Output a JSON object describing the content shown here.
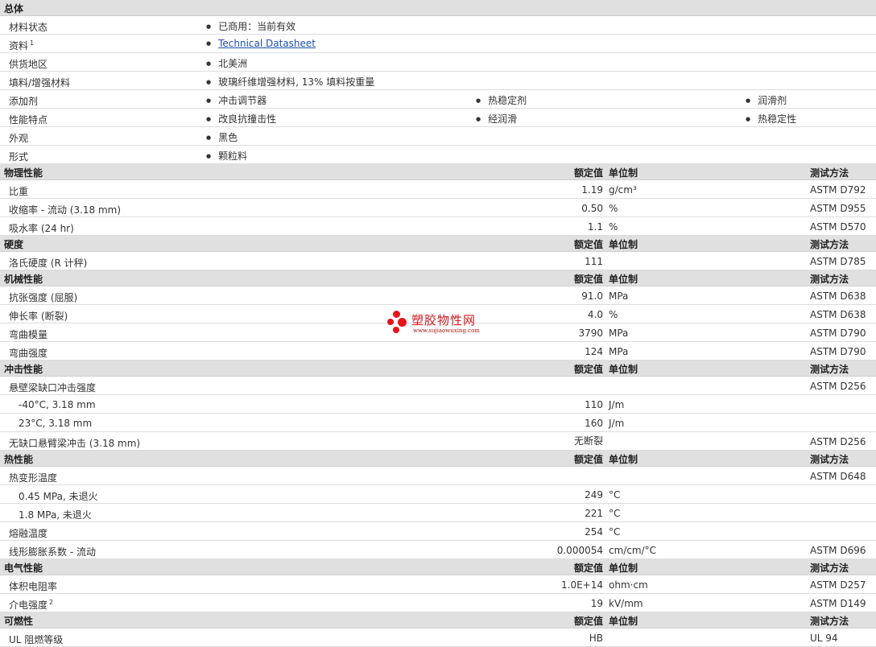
{
  "headers": {
    "value": "额定值",
    "unit": "单位制",
    "method": "测试方法"
  },
  "general": {
    "title": "总体",
    "rows": [
      {
        "label": "材料状态",
        "items": [
          "已商用：当前有效"
        ]
      },
      {
        "label": "资料",
        "sup": "1",
        "link": "Technical Datasheet"
      },
      {
        "label": "供货地区",
        "items": [
          "北美洲"
        ]
      },
      {
        "label": "填料/增强材料",
        "items": [
          "玻璃纤维增强材料, 13% 填料按重量"
        ]
      },
      {
        "label": "添加剂",
        "items": [
          "冲击调节器",
          "热稳定剂",
          "润滑剂"
        ]
      },
      {
        "label": "性能特点",
        "items": [
          "改良抗撞击性",
          "经润滑",
          "热稳定性"
        ]
      },
      {
        "label": "外观",
        "items": [
          "黑色"
        ]
      },
      {
        "label": "形式",
        "items": [
          "颗粒料"
        ]
      }
    ]
  },
  "sections": [
    {
      "title": "物理性能",
      "rows": [
        {
          "label": "比重",
          "value": "1.19",
          "unit": "g/cm³",
          "method": "ASTM D792"
        },
        {
          "label": "收缩率  - 流动  (3.18 mm)",
          "value": "0.50",
          "unit": "%",
          "method": "ASTM D955"
        },
        {
          "label": "吸水率  (24 hr)",
          "value": "1.1",
          "unit": "%",
          "method": "ASTM D570"
        }
      ]
    },
    {
      "title": "硬度",
      "rows": [
        {
          "label": "洛氏硬度  (R 计秤)",
          "value": "111",
          "unit": "",
          "method": "ASTM D785"
        }
      ]
    },
    {
      "title": "机械性能",
      "rows": [
        {
          "label": "抗张强度  (屈服)",
          "value": "91.0",
          "unit": "MPa",
          "method": "ASTM D638"
        },
        {
          "label": "伸长率  (断裂)",
          "value": "4.0",
          "unit": "%",
          "method": "ASTM D638"
        },
        {
          "label": "弯曲模量",
          "value": "3790",
          "unit": "MPa",
          "method": "ASTM D790"
        },
        {
          "label": "弯曲强度",
          "value": "124",
          "unit": "MPa",
          "method": "ASTM D790"
        }
      ]
    },
    {
      "title": "冲击性能",
      "rows": [
        {
          "label": "悬壁梁缺口冲击强度",
          "value": "",
          "unit": "",
          "method": "ASTM D256"
        },
        {
          "label": "-40°C, 3.18 mm",
          "value": "110",
          "unit": "J/m",
          "method": "",
          "sub": true
        },
        {
          "label": "23°C, 3.18 mm",
          "value": "160",
          "unit": "J/m",
          "method": "",
          "sub": true
        },
        {
          "label": "无缺口悬臂梁冲击  (3.18 mm)",
          "value": "无断裂",
          "unit": "",
          "method": "ASTM D256"
        }
      ]
    },
    {
      "title": "热性能",
      "rows": [
        {
          "label": "热变形温度",
          "value": "",
          "unit": "",
          "method": "ASTM D648"
        },
        {
          "label": "0.45 MPa, 未退火",
          "value": "249",
          "unit": "°C",
          "method": "",
          "sub": true
        },
        {
          "label": "1.8 MPa, 未退火",
          "value": "221",
          "unit": "°C",
          "method": "",
          "sub": true
        },
        {
          "label": "熔融温度",
          "value": "254",
          "unit": "°C",
          "method": ""
        },
        {
          "label": "线形膨胀系数  - 流动",
          "value": "0.000054",
          "unit": "cm/cm/°C",
          "method": "ASTM D696"
        }
      ]
    },
    {
      "title": "电气性能",
      "rows": [
        {
          "label": "体积电阻率",
          "value": "1.0E+14",
          "unit": "ohm·cm",
          "method": "ASTM D257"
        },
        {
          "label": "介电强度",
          "sup": "2",
          "value": "19",
          "unit": "kV/mm",
          "method": "ASTM D149"
        }
      ]
    },
    {
      "title": "可燃性",
      "rows": [
        {
          "label": "UL 阻燃等级",
          "value": "HB",
          "unit": "",
          "method": "UL 94"
        }
      ]
    }
  ],
  "watermark": {
    "name": "塑胶物性网",
    "url": "www.sujiaowuxing.com",
    "color": "#e4151b"
  }
}
